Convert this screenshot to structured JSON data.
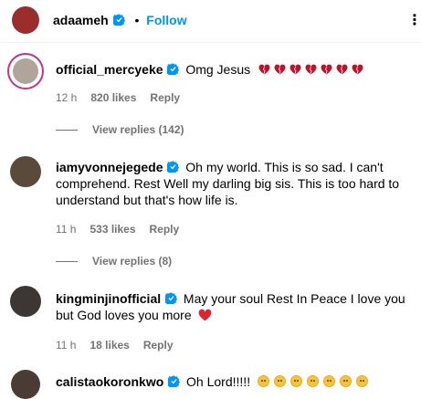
{
  "header": {
    "username": "adaameh",
    "dot": "•",
    "follow_label": "Follow",
    "more": "⋮"
  },
  "comments": [
    {
      "username": "official_mercyeke",
      "text": "Omg Jesus",
      "emojis": [
        "broken-heart",
        "broken-heart",
        "broken-heart",
        "broken-heart",
        "broken-heart",
        "broken-heart",
        "broken-heart"
      ],
      "time": "12 h",
      "likes": "820 likes",
      "reply": "Reply",
      "view_replies": "View replies (142)"
    },
    {
      "username": "iamyvonnejegede",
      "text": "Oh my world. This is so sad. I can't comprehend. Rest Well my darling big sis. This is too hard to understand but that's how life is.",
      "time": "11 h",
      "likes": "533 likes",
      "reply": "Reply",
      "view_replies": "View replies (8)"
    },
    {
      "username": "kingminjinofficial",
      "text": "May your soul Rest In Peace I love you but God loves you more",
      "emojis": [
        "red-heart"
      ],
      "time": "11 h",
      "likes": "18 likes",
      "reply": "Reply"
    },
    {
      "username": "calistaokoronkwo",
      "text": "Oh Lord!!!!!",
      "emojis": [
        "sad-face",
        "sad-face",
        "sad-face",
        "sad-face",
        "sad-face",
        "sad-face",
        "sad-face"
      ]
    }
  ],
  "colors": {
    "verified": "#0095f6",
    "follow": "#0095f6",
    "heart": "#e0242f"
  }
}
